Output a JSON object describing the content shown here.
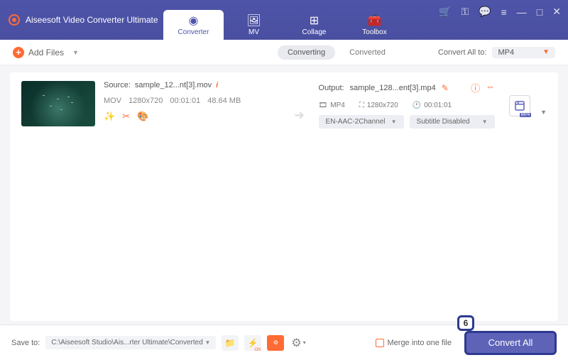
{
  "app": {
    "title": "Aiseesoft Video Converter Ultimate"
  },
  "nav": {
    "converter": "Converter",
    "mv": "MV",
    "collage": "Collage",
    "toolbox": "Toolbox"
  },
  "toolbar": {
    "add_files": "Add Files",
    "converting": "Converting",
    "converted": "Converted",
    "convert_all_to": "Convert All to:",
    "format": "MP4"
  },
  "item": {
    "source_label": "Source:",
    "source_file": "sample_12...nt[3].mov",
    "format": "MOV",
    "resolution": "1280x720",
    "duration": "00:01:01",
    "size": "48.64 MB",
    "output_label": "Output:",
    "output_file": "sample_128...ent[3].mp4",
    "out_format": "MP4",
    "out_resolution": "1280x720",
    "out_duration": "00:01:01",
    "audio_select": "EN-AAC-2Channel",
    "subtitle_select": "Subtitle Disabled",
    "edit_badge": "MP4"
  },
  "bottom": {
    "save_to_label": "Save to:",
    "path": "C:\\Aiseesoft Studio\\Ais...rter Ultimate\\Converted",
    "merge_label": "Merge into one file",
    "convert_btn": "Convert All",
    "step": "6"
  }
}
